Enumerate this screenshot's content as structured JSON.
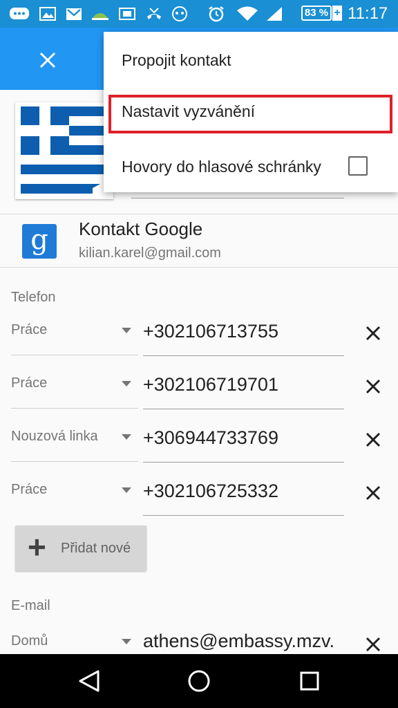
{
  "status_bar": {
    "battery": "83 %",
    "battery_plus": "+",
    "time": "11:17"
  },
  "toolbar": {
    "close_icon": "close-icon"
  },
  "account": {
    "title": "Kontakt Google",
    "email": "kilian.karel@gmail.com",
    "logo_letter": "g"
  },
  "phone_section": {
    "label": "Telefon",
    "entries": [
      {
        "type": "Práce",
        "number": "+302106713755"
      },
      {
        "type": "Práce",
        "number": "+302106719701"
      },
      {
        "type": "Nouzová linka",
        "number": "+306944733769"
      },
      {
        "type": "Práce",
        "number": "+302106725332"
      }
    ],
    "add_label": "Přidat nové"
  },
  "email_section": {
    "label": "E-mail",
    "entry": {
      "type": "Domů",
      "value": "athens@embassy.mzv."
    }
  },
  "menu": {
    "items": [
      {
        "label": "Propojit kontakt"
      },
      {
        "label": "Nastavit vyzvánění"
      },
      {
        "label": "Hovory do hlasové schránky",
        "checked": false
      }
    ]
  },
  "colors": {
    "status_bar": "#1a8fd3",
    "toolbar": "#2196f3",
    "highlight": "#e0202a"
  }
}
